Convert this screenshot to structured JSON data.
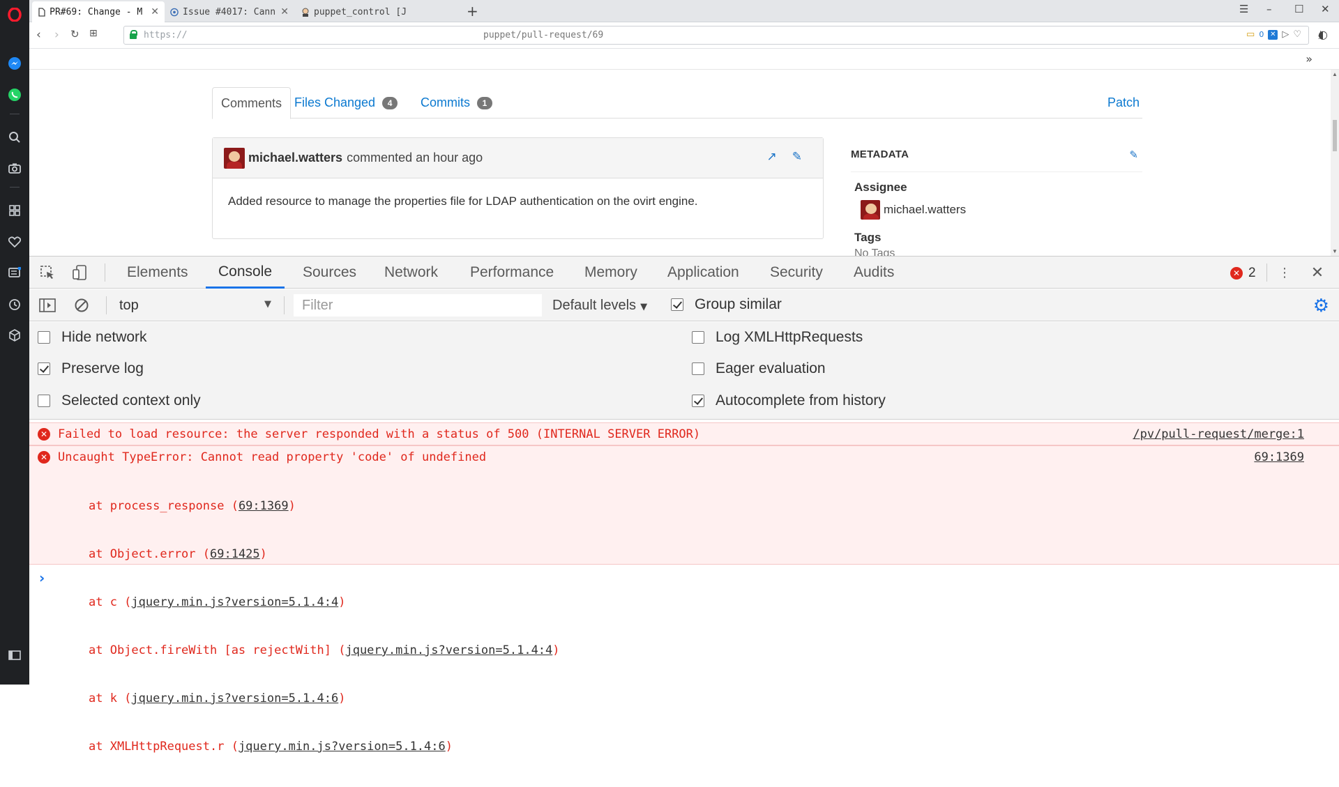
{
  "browser": {
    "tabs": [
      {
        "label": "PR#69: Change - M"
      },
      {
        "label": "Issue #4017: Cann"
      },
      {
        "label": "puppet_control [J"
      }
    ],
    "new_tab": "+",
    "url_prefix": "https://",
    "url_path": "puppet/pull-request/69",
    "ublock_count": "0"
  },
  "page": {
    "tabs": [
      {
        "label": "Comments"
      },
      {
        "label": "Files Changed",
        "count": "4"
      },
      {
        "label": "Commits",
        "count": "1"
      }
    ],
    "patch_label": "Patch",
    "comment": {
      "author": "michael.watters",
      "action_time": "commented an hour ago",
      "body": "Added resource to manage the properties file for LDAP authentication on the ovirt engine."
    },
    "metadata": {
      "title": "METADATA",
      "assignee_label": "Assignee",
      "assignee": "michael.watters",
      "tags_label": "Tags",
      "tags_value": "No Tags"
    }
  },
  "devtools": {
    "tabs": [
      "Elements",
      "Console",
      "Sources",
      "Network",
      "Performance",
      "Memory",
      "Application",
      "Security",
      "Audits"
    ],
    "active_tab": "Console",
    "error_count": "2",
    "context": "top",
    "filter_placeholder": "Filter",
    "levels_label": "Default levels",
    "group_similar": {
      "label": "Group similar",
      "checked": true
    },
    "settings": {
      "left": [
        {
          "label": "Hide network",
          "checked": false
        },
        {
          "label": "Preserve log",
          "checked": true
        },
        {
          "label": "Selected context only",
          "checked": false
        }
      ],
      "right": [
        {
          "label": "Log XMLHttpRequests",
          "checked": false
        },
        {
          "label": "Eager evaluation",
          "checked": false
        },
        {
          "label": "Autocomplete from history",
          "checked": true
        }
      ]
    },
    "messages": [
      {
        "text": "Failed to load resource: the server responded with a status of 500 (INTERNAL SERVER ERROR)",
        "source": "/pv/pull-request/merge:1"
      },
      {
        "text": "Uncaught TypeError: Cannot read property 'code' of undefined",
        "source": "69:1369",
        "stack": [
          {
            "prefix": "at process_response (",
            "link": "69:1369",
            "suffix": ")"
          },
          {
            "prefix": "at Object.error (",
            "link": "69:1425",
            "suffix": ")"
          },
          {
            "prefix": "at c (",
            "link": "jquery.min.js?version=5.1.4:4",
            "suffix": ")"
          },
          {
            "prefix": "at Object.fireWith [as rejectWith] (",
            "link": "jquery.min.js?version=5.1.4:4",
            "suffix": ")"
          },
          {
            "prefix": "at k (",
            "link": "jquery.min.js?version=5.1.4:6",
            "suffix": ")"
          },
          {
            "prefix": "at XMLHttpRequest.r (",
            "link": "jquery.min.js?version=5.1.4:6",
            "suffix": ")"
          }
        ]
      }
    ],
    "prompt_symbol": "›"
  },
  "colors": {
    "error_red": "#e0281d",
    "link_blue": "#0b79d0",
    "devtools_accent": "#1a73e8",
    "opera_red": "#ff1b2d"
  }
}
